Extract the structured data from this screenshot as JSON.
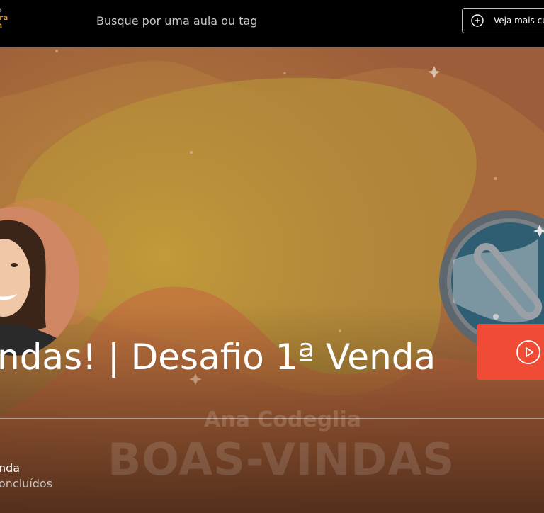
{
  "header": {
    "logo_line1": "o",
    "logo_line2": "ira",
    "logo_line3": "n",
    "search_placeholder": "Busque por uma aula ou tag",
    "more_button_label": "Veja mais cursos"
  },
  "hero": {
    "lesson_title": "ndas! | Desafio 1ª Venda",
    "thumbnail_name": "Ana Codeglia",
    "thumbnail_title": "BOAS-VINDAS",
    "course_name": "nda",
    "progress_text": "oncluídos"
  },
  "icons": {
    "more_button": "plus-circle-icon",
    "play_button": "play-circle-icon"
  },
  "colors": {
    "accent": "#ef4b35",
    "logo": "#f2a23a",
    "header_bg": "#000000"
  }
}
